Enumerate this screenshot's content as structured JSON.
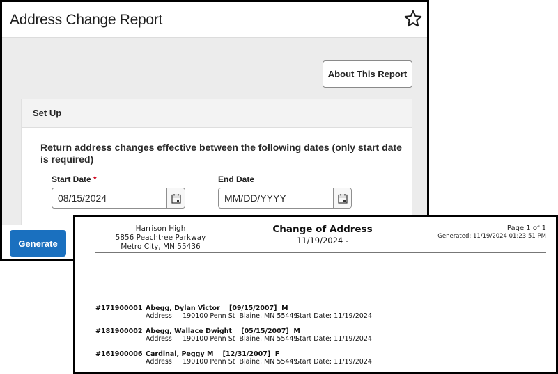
{
  "app": {
    "title": "Address Change Report",
    "favorite_icon": "star-outline-icon",
    "about_button_label": "About This Report",
    "setup": {
      "header": "Set Up",
      "instructions": "Return address changes effective between the following dates (only start date is required)",
      "start_date": {
        "label": "Start Date",
        "required_marker": "*",
        "value": "08/15/2024",
        "placeholder": "MM/DD/YYYY",
        "icon": "calendar-icon"
      },
      "end_date": {
        "label": "End Date",
        "value": "",
        "placeholder": "MM/DD/YYYY",
        "icon": "calendar-icon"
      }
    },
    "generate_button_label": "Generate",
    "colors": {
      "primary_button": "#1a70bf",
      "required": "#d0021b",
      "background": "#ececec"
    }
  },
  "report": {
    "school": {
      "name": "Harrison High",
      "street": "5856 Peachtree Parkway",
      "city_state_zip": "Metro City, MN 55436"
    },
    "title": "Change of Address",
    "date_range": "11/19/2024 -",
    "page_info": "Page 1 of 1",
    "generated": "Generated: 11/19/2024  01:23:51 PM",
    "records": [
      {
        "id": "#171900001",
        "name_line": "Abegg, Dylan Victor    [09/15/2007]  M",
        "address_line": "Address:    190100 Penn St  Blaine, MN 55449",
        "start_date_line": "Start Date: 11/19/2024"
      },
      {
        "id": "#181900002",
        "name_line": "Abegg, Wallace Dwight    [05/15/2007]  M",
        "address_line": "Address:    190100 Penn St  Blaine, MN 55449",
        "start_date_line": "Start Date: 11/19/2024"
      },
      {
        "id": "#161900006",
        "name_line": "Cardinal, Peggy M    [12/31/2007]  F",
        "address_line": "Address:    190100 Penn St  Blaine, MN 55449",
        "start_date_line": "Start Date: 11/19/2024"
      }
    ]
  }
}
